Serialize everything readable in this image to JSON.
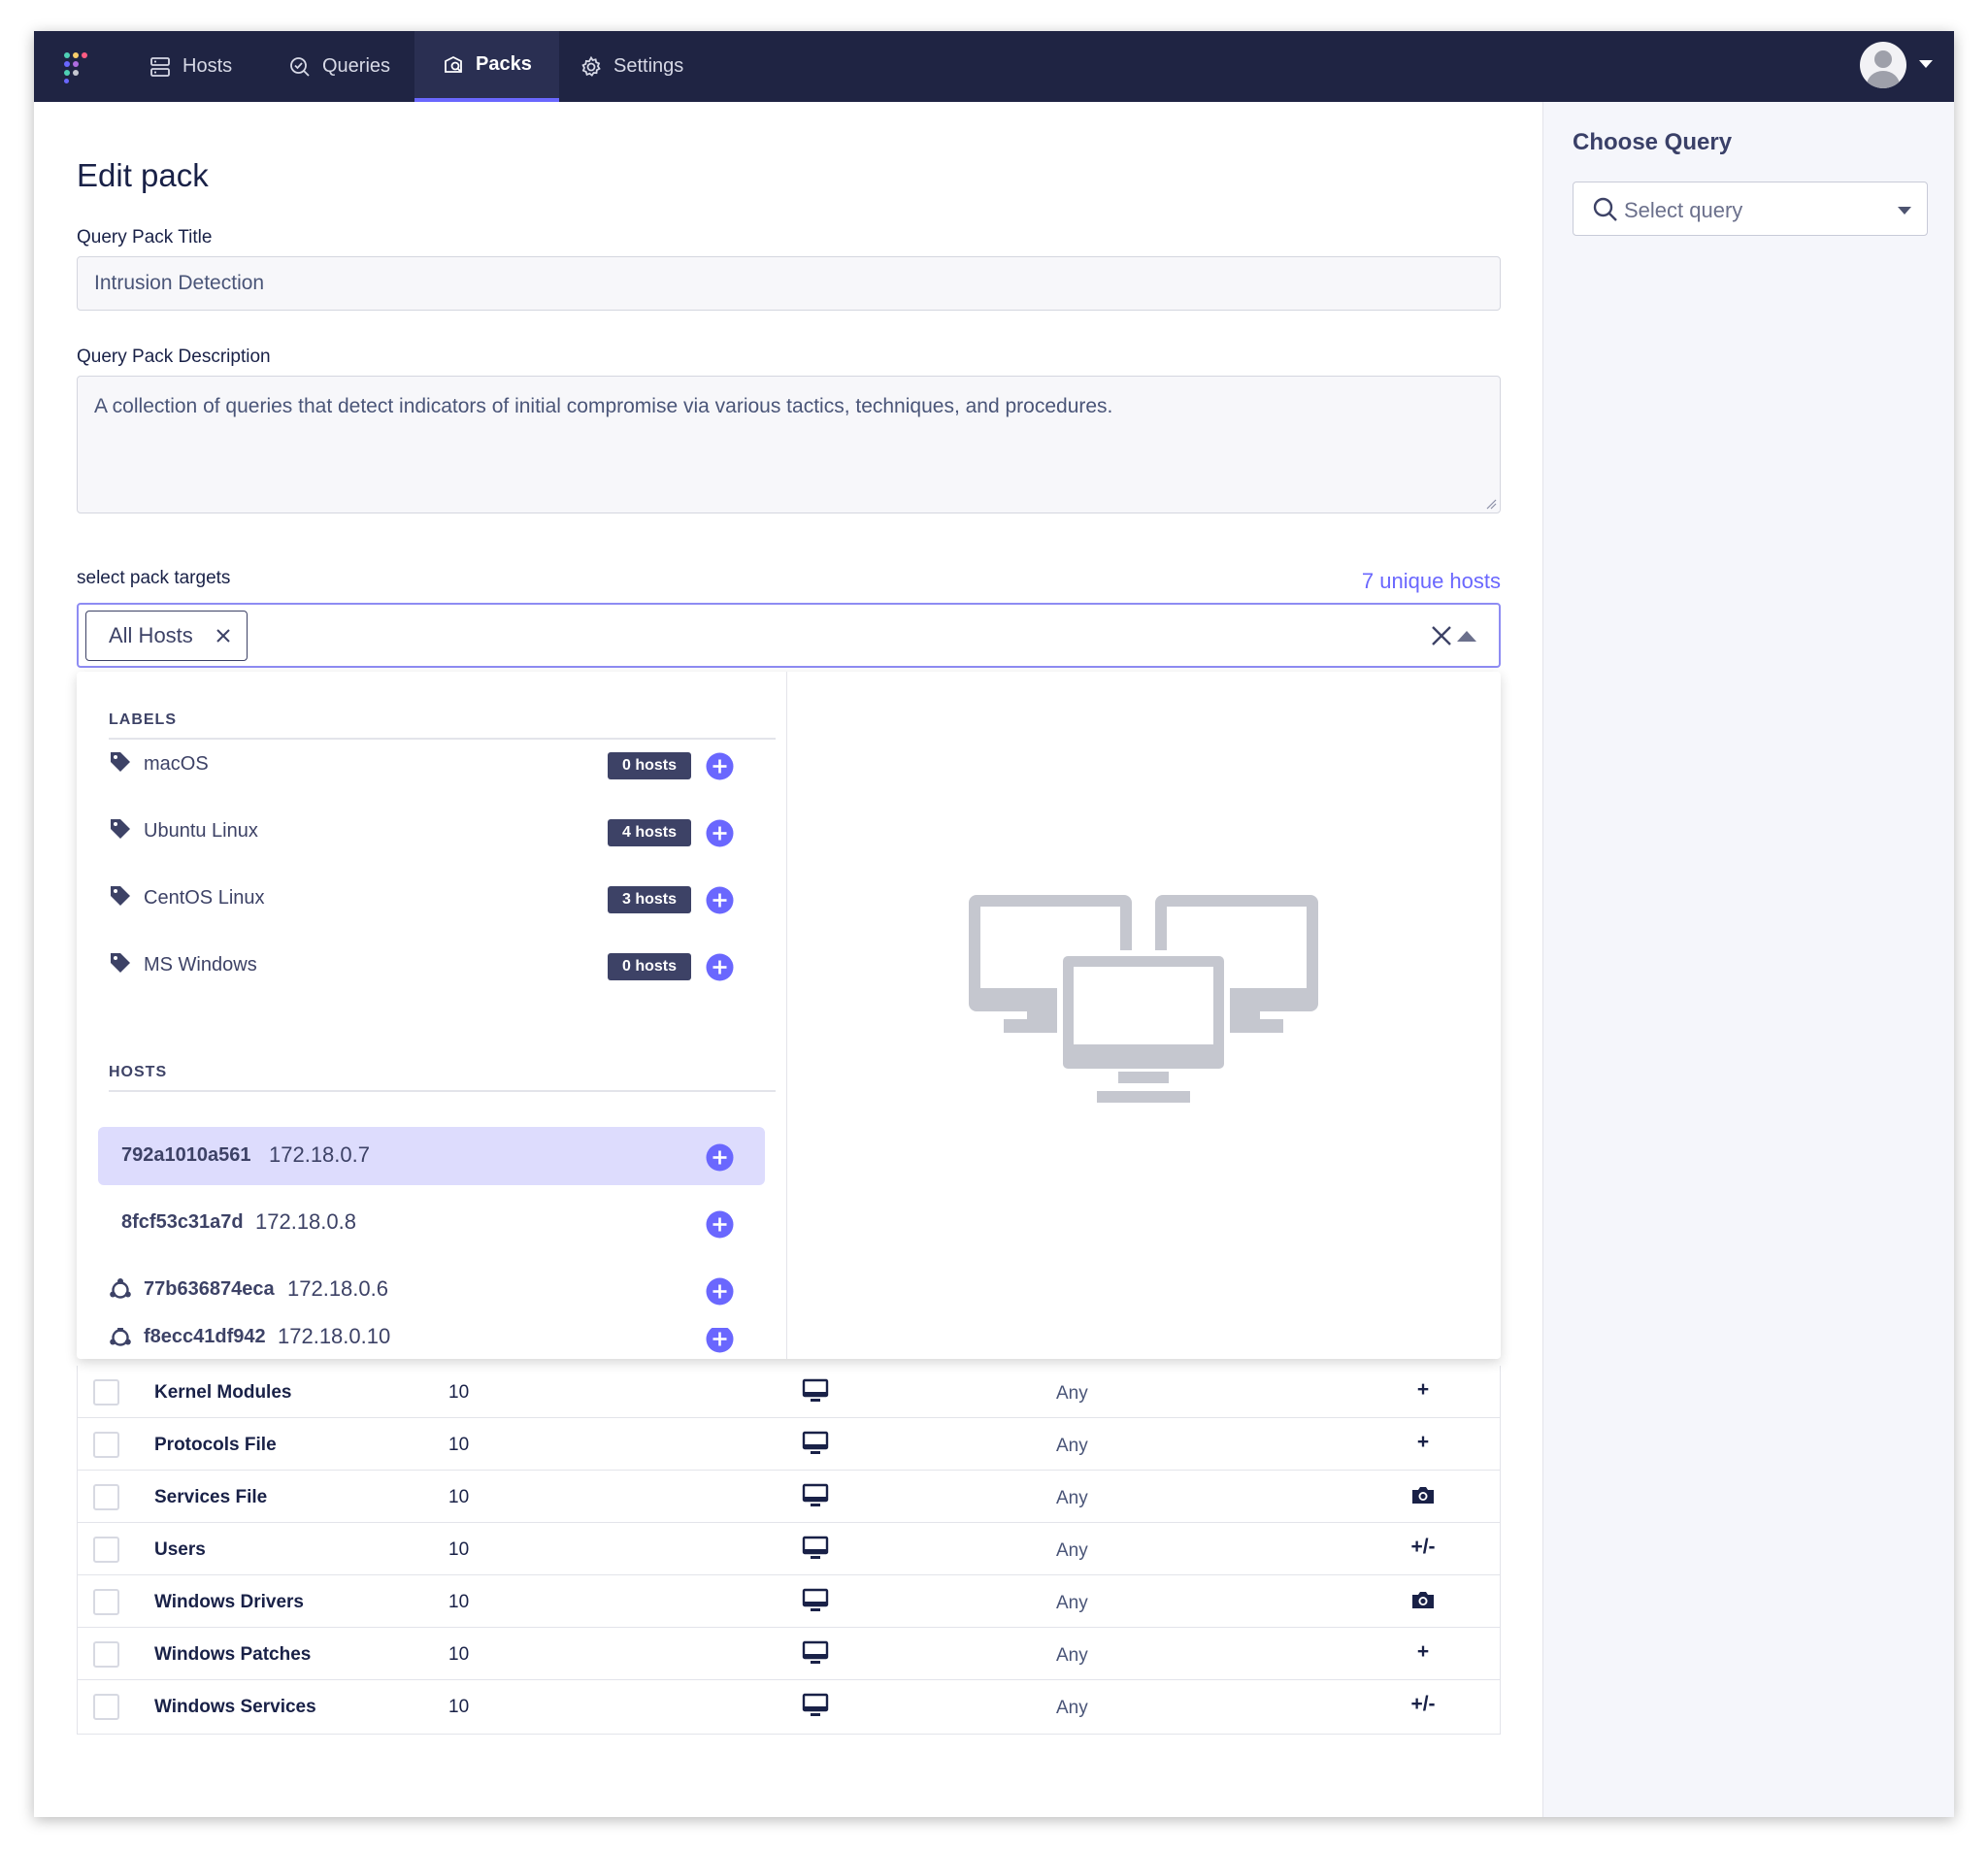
{
  "nav": {
    "items": [
      {
        "label": "Hosts",
        "icon": "hosts-icon"
      },
      {
        "label": "Queries",
        "icon": "queries-icon"
      },
      {
        "label": "Packs",
        "icon": "packs-icon",
        "active": true
      },
      {
        "label": "Settings",
        "icon": "gear-icon"
      }
    ],
    "logo_colors": [
      "#4fd0b5",
      "#f8cd6b",
      "#ff5c83",
      "#6a67fe",
      "#ae6ddf",
      "#c5c7d1",
      "#4fd0b5",
      "#6a67fe",
      "#c5c7d1"
    ]
  },
  "sidebar": {
    "title": "Choose Query",
    "select_placeholder": "Select query"
  },
  "page": {
    "title": "Edit pack",
    "title_label": "Query Pack Title",
    "title_value": "Intrusion Detection",
    "description_label": "Query Pack Description",
    "description_value": "A collection of queries that detect indicators of initial compromise via various tactics, techniques, and procedures.",
    "targets_label": "select pack targets",
    "unique_hosts": "7 unique hosts",
    "selected_target": "All Hosts"
  },
  "dropdown": {
    "labels_header": "LABELS",
    "labels": [
      {
        "name": "macOS",
        "count": "0 hosts"
      },
      {
        "name": "Ubuntu Linux",
        "count": "4 hosts"
      },
      {
        "name": "CentOS Linux",
        "count": "3 hosts"
      },
      {
        "name": "MS Windows",
        "count": "0 hosts"
      }
    ],
    "hosts_header": "HOSTS",
    "hosts": [
      {
        "name": "792a1010a561",
        "ip": "172.18.0.7",
        "icon": null,
        "highlighted": true
      },
      {
        "name": "8fcf53c31a7d",
        "ip": "172.18.0.8",
        "icon": null,
        "highlighted": false
      },
      {
        "name": "77b636874eca",
        "ip": "172.18.0.6",
        "icon": "ubuntu-icon",
        "highlighted": false
      },
      {
        "name": "f8ecc41df942",
        "ip": "172.18.0.10",
        "icon": "ubuntu-icon",
        "highlighted": false
      }
    ]
  },
  "queries": [
    {
      "name": "Kernel Modules",
      "interval": "10",
      "platform": "desktop-icon",
      "version": "Any",
      "logging": "+"
    },
    {
      "name": "Protocols File",
      "interval": "10",
      "platform": "desktop-icon",
      "version": "Any",
      "logging": "+"
    },
    {
      "name": "Services File",
      "interval": "10",
      "platform": "desktop-icon",
      "version": "Any",
      "logging": "camera-icon"
    },
    {
      "name": "Users",
      "interval": "10",
      "platform": "desktop-icon",
      "version": "Any",
      "logging": "+/-"
    },
    {
      "name": "Windows Drivers",
      "interval": "10",
      "platform": "desktop-icon",
      "version": "Any",
      "logging": "camera-icon"
    },
    {
      "name": "Windows Patches",
      "interval": "10",
      "platform": "desktop-icon",
      "version": "Any",
      "logging": "+"
    },
    {
      "name": "Windows Services",
      "interval": "10",
      "platform": "desktop-icon",
      "version": "Any",
      "logging": "+/-"
    }
  ],
  "colors": {
    "nav_bg": "#1f2443",
    "accent": "#6a67fe",
    "badge_bg": "#3d4266",
    "highlight_row": "#dddcfd",
    "text_dark": "#192147"
  }
}
